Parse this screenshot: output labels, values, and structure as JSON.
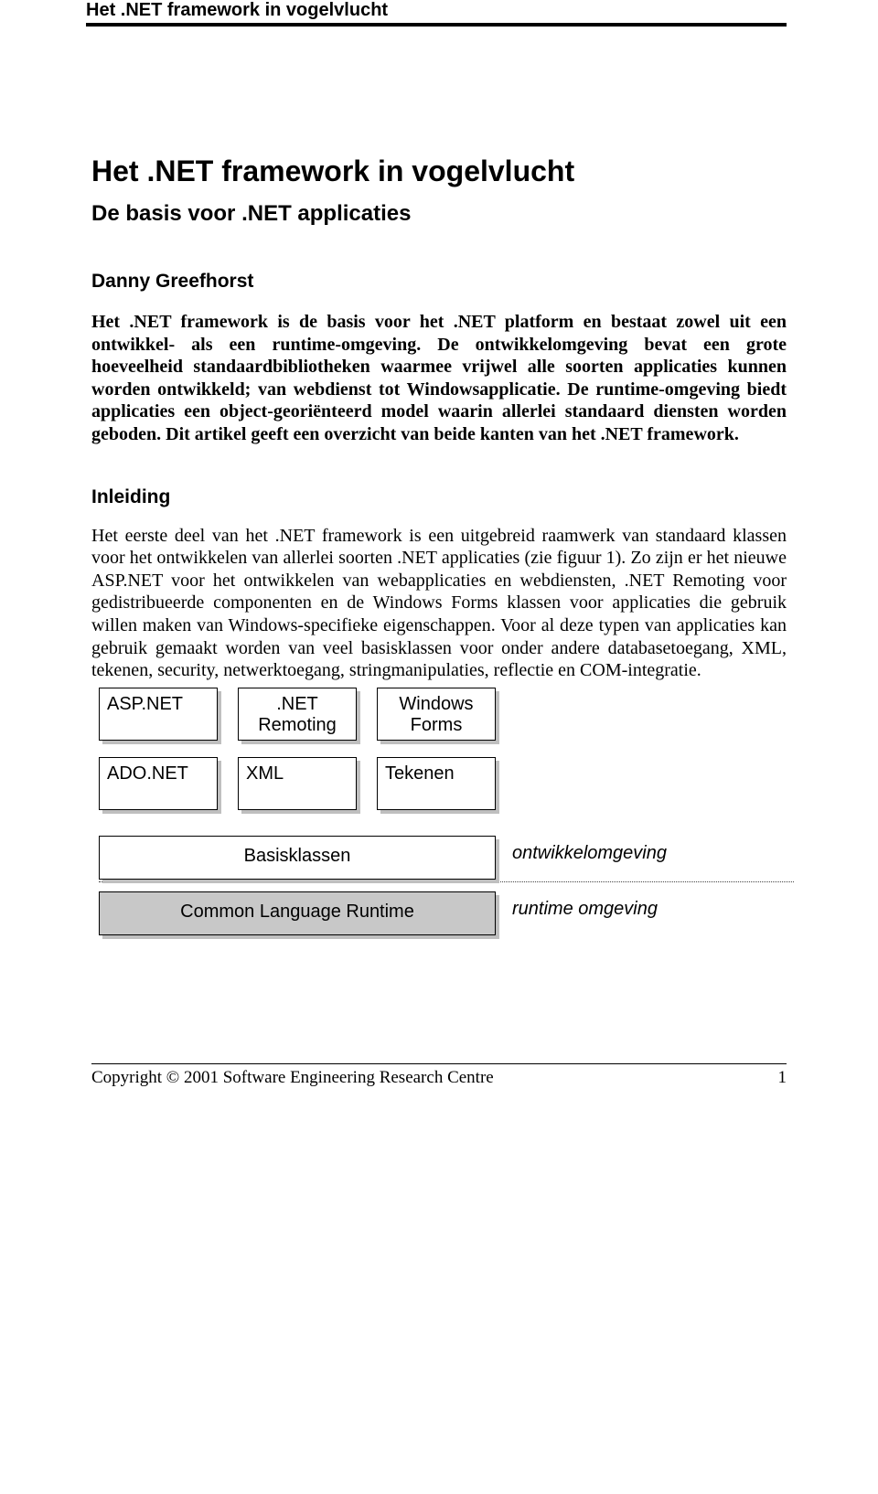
{
  "header": {
    "running_title": "Het .NET framework in vogelvlucht"
  },
  "title": "Het .NET framework in vogelvlucht",
  "subtitle": "De basis voor .NET applicaties",
  "author": "Danny Greefhorst",
  "abstract": "Het .NET framework is de basis voor het .NET platform en bestaat zowel uit een ontwikkel- als een runtime-omgeving. De ontwikkelomgeving bevat een grote hoeveelheid standaardbibliotheken waarmee vrijwel alle soorten applicaties kunnen worden ontwikkeld; van webdienst tot Windowsapplicatie. De runtime-omgeving biedt applicaties een object-georiënteerd model waarin allerlei standaard diensten worden geboden. Dit artikel geeft een overzicht van beide kanten van het .NET framework.",
  "sections": {
    "inleiding": {
      "heading": "Inleiding",
      "p1": "Het eerste deel van het .NET framework is een uitgebreid raamwerk van standaard klassen voor het ontwikkelen van allerlei soorten .NET applicaties (zie figuur 1). Zo zijn er het nieuwe ASP.NET voor het ontwikkelen van webapplicaties en webdiensten, .NET Remoting voor gedistribueerde componenten en de Windows Forms klassen voor applicaties die gebruik willen maken van Windows-specifieke eigenschappen. Voor al deze typen van applicaties kan gebruik gemaakt worden van veel basisklassen voor onder andere databasetoegang, XML, tekenen, security, netwerktoegang, stringmanipulaties, reflectie en COM-integratie."
    }
  },
  "diagram": {
    "row1": [
      "ASP.NET",
      ".NET Remoting",
      "Windows Forms"
    ],
    "row2": [
      "ADO.NET",
      "XML",
      "Tekenen"
    ],
    "wide1": "Basisklassen",
    "wide2": "Common Language Runtime",
    "annot1": "ontwikkelomgeving",
    "annot2": "runtime omgeving"
  },
  "footer": {
    "copyright": "Copyright © 2001 Software Engineering Research Centre",
    "page": "1"
  }
}
